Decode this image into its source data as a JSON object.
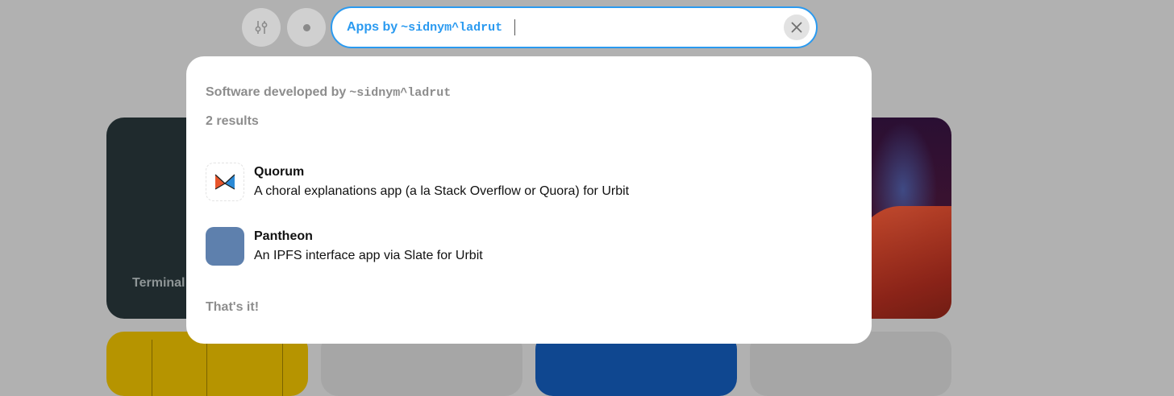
{
  "background": {
    "tiles": [
      {
        "label": "Terminal"
      }
    ]
  },
  "toolbar": {
    "settings_icon": "sliders-icon",
    "status_icon": "dot-icon"
  },
  "search": {
    "prefix": "Apps by",
    "ship": "~sidnym^ladrut",
    "value": "",
    "clear_icon": "close-icon"
  },
  "panel": {
    "heading": "Software developed by",
    "ship": "~sidnym^ladrut",
    "count": "2 results",
    "results": [
      {
        "title": "Quorum",
        "description": "A choral explanations app (a la Stack Overflow or Quora) for Urbit",
        "icon_color": "#ffffff"
      },
      {
        "title": "Pantheon",
        "description": "An IPFS interface app via Slate for Urbit",
        "icon_color": "#5e80ad"
      }
    ],
    "footer": "That's it!"
  },
  "colors": {
    "accent": "#2a9af0",
    "overlay_bg": "#b1b1b1"
  }
}
